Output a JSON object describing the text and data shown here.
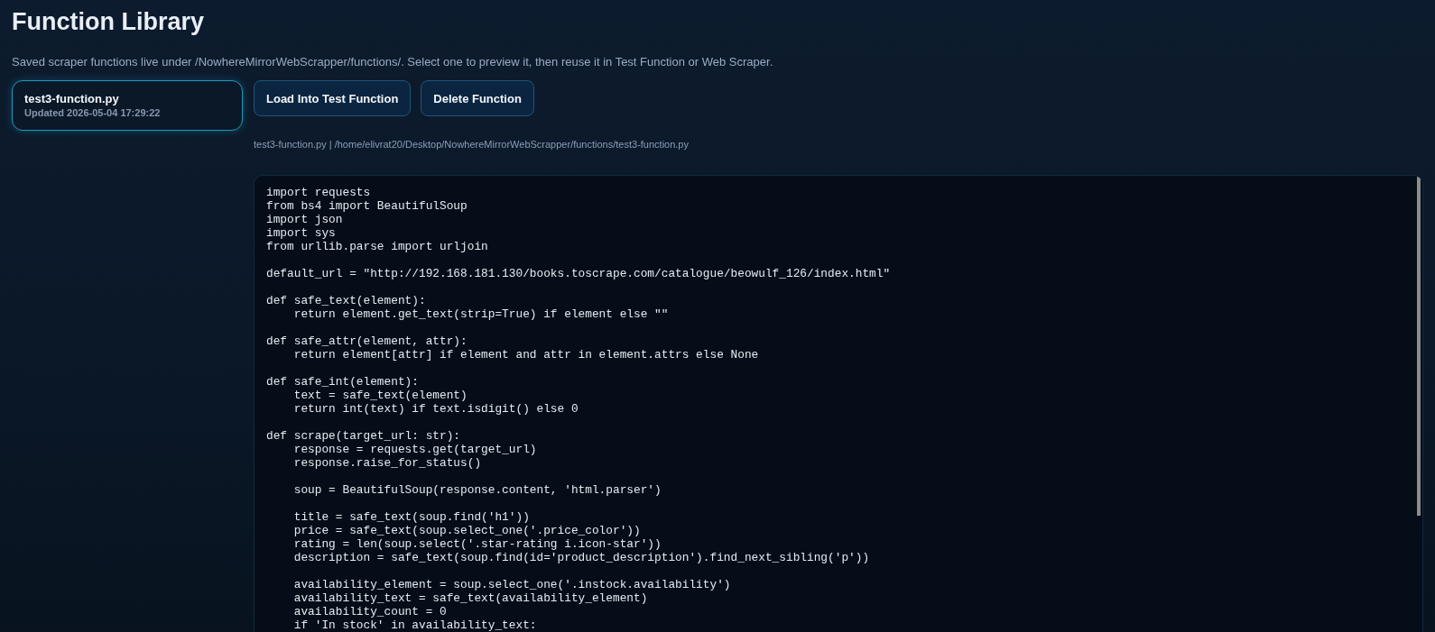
{
  "page": {
    "title": "Function Library",
    "description": "Saved scraper functions live under /NowhereMirrorWebScrapper/functions/. Select one to preview it, then reuse it in Test Function or Web Scraper."
  },
  "functions": [
    {
      "name": "test3-function.py",
      "updated": "Updated 2026-05-04 17:29:22",
      "selected": true
    }
  ],
  "buttons": [
    "Load Into Test Function",
    "Delete Function"
  ],
  "preview": {
    "path": "test3-function.py | /home/elivrat20/Desktop/NowhereMirrorWebScrapper/functions/test3-function.py",
    "code_blocks": [
      [
        "import requests",
        "from bs4 import BeautifulSoup",
        "import json",
        "import sys",
        "from urllib.parse import urljoin"
      ],
      [
        "default_url = \"http://192.168.181.130/books.toscrape.com/catalogue/beowulf_126/index.html\""
      ],
      [
        "def safe_text(element):",
        "    return element.get_text(strip=True) if element else \"\""
      ],
      [
        "def safe_attr(element, attr):",
        "    return element[attr] if element and attr in element.attrs else None"
      ],
      [
        "def safe_int(element):",
        "    text = safe_text(element)",
        "    return int(text) if text.isdigit() else 0"
      ],
      [
        "def scrape(target_url: str):",
        "    response = requests.get(target_url)",
        "    response.raise_for_status()"
      ],
      [
        "    soup = BeautifulSoup(response.content, 'html.parser')"
      ],
      [
        "    title = safe_text(soup.find('h1'))",
        "    price = safe_text(soup.select_one('.price_color'))",
        "    rating = len(soup.select('.star-rating i.icon-star'))",
        "    description = safe_text(soup.find(id='product_description').find_next_sibling('p'))"
      ],
      [
        "    availability_element = soup.select_one('.instock.availability')",
        "    availability_text = safe_text(availability_element)",
        "    availability_count = 0",
        "    if 'In stock' in availability_text:"
      ]
    ]
  }
}
